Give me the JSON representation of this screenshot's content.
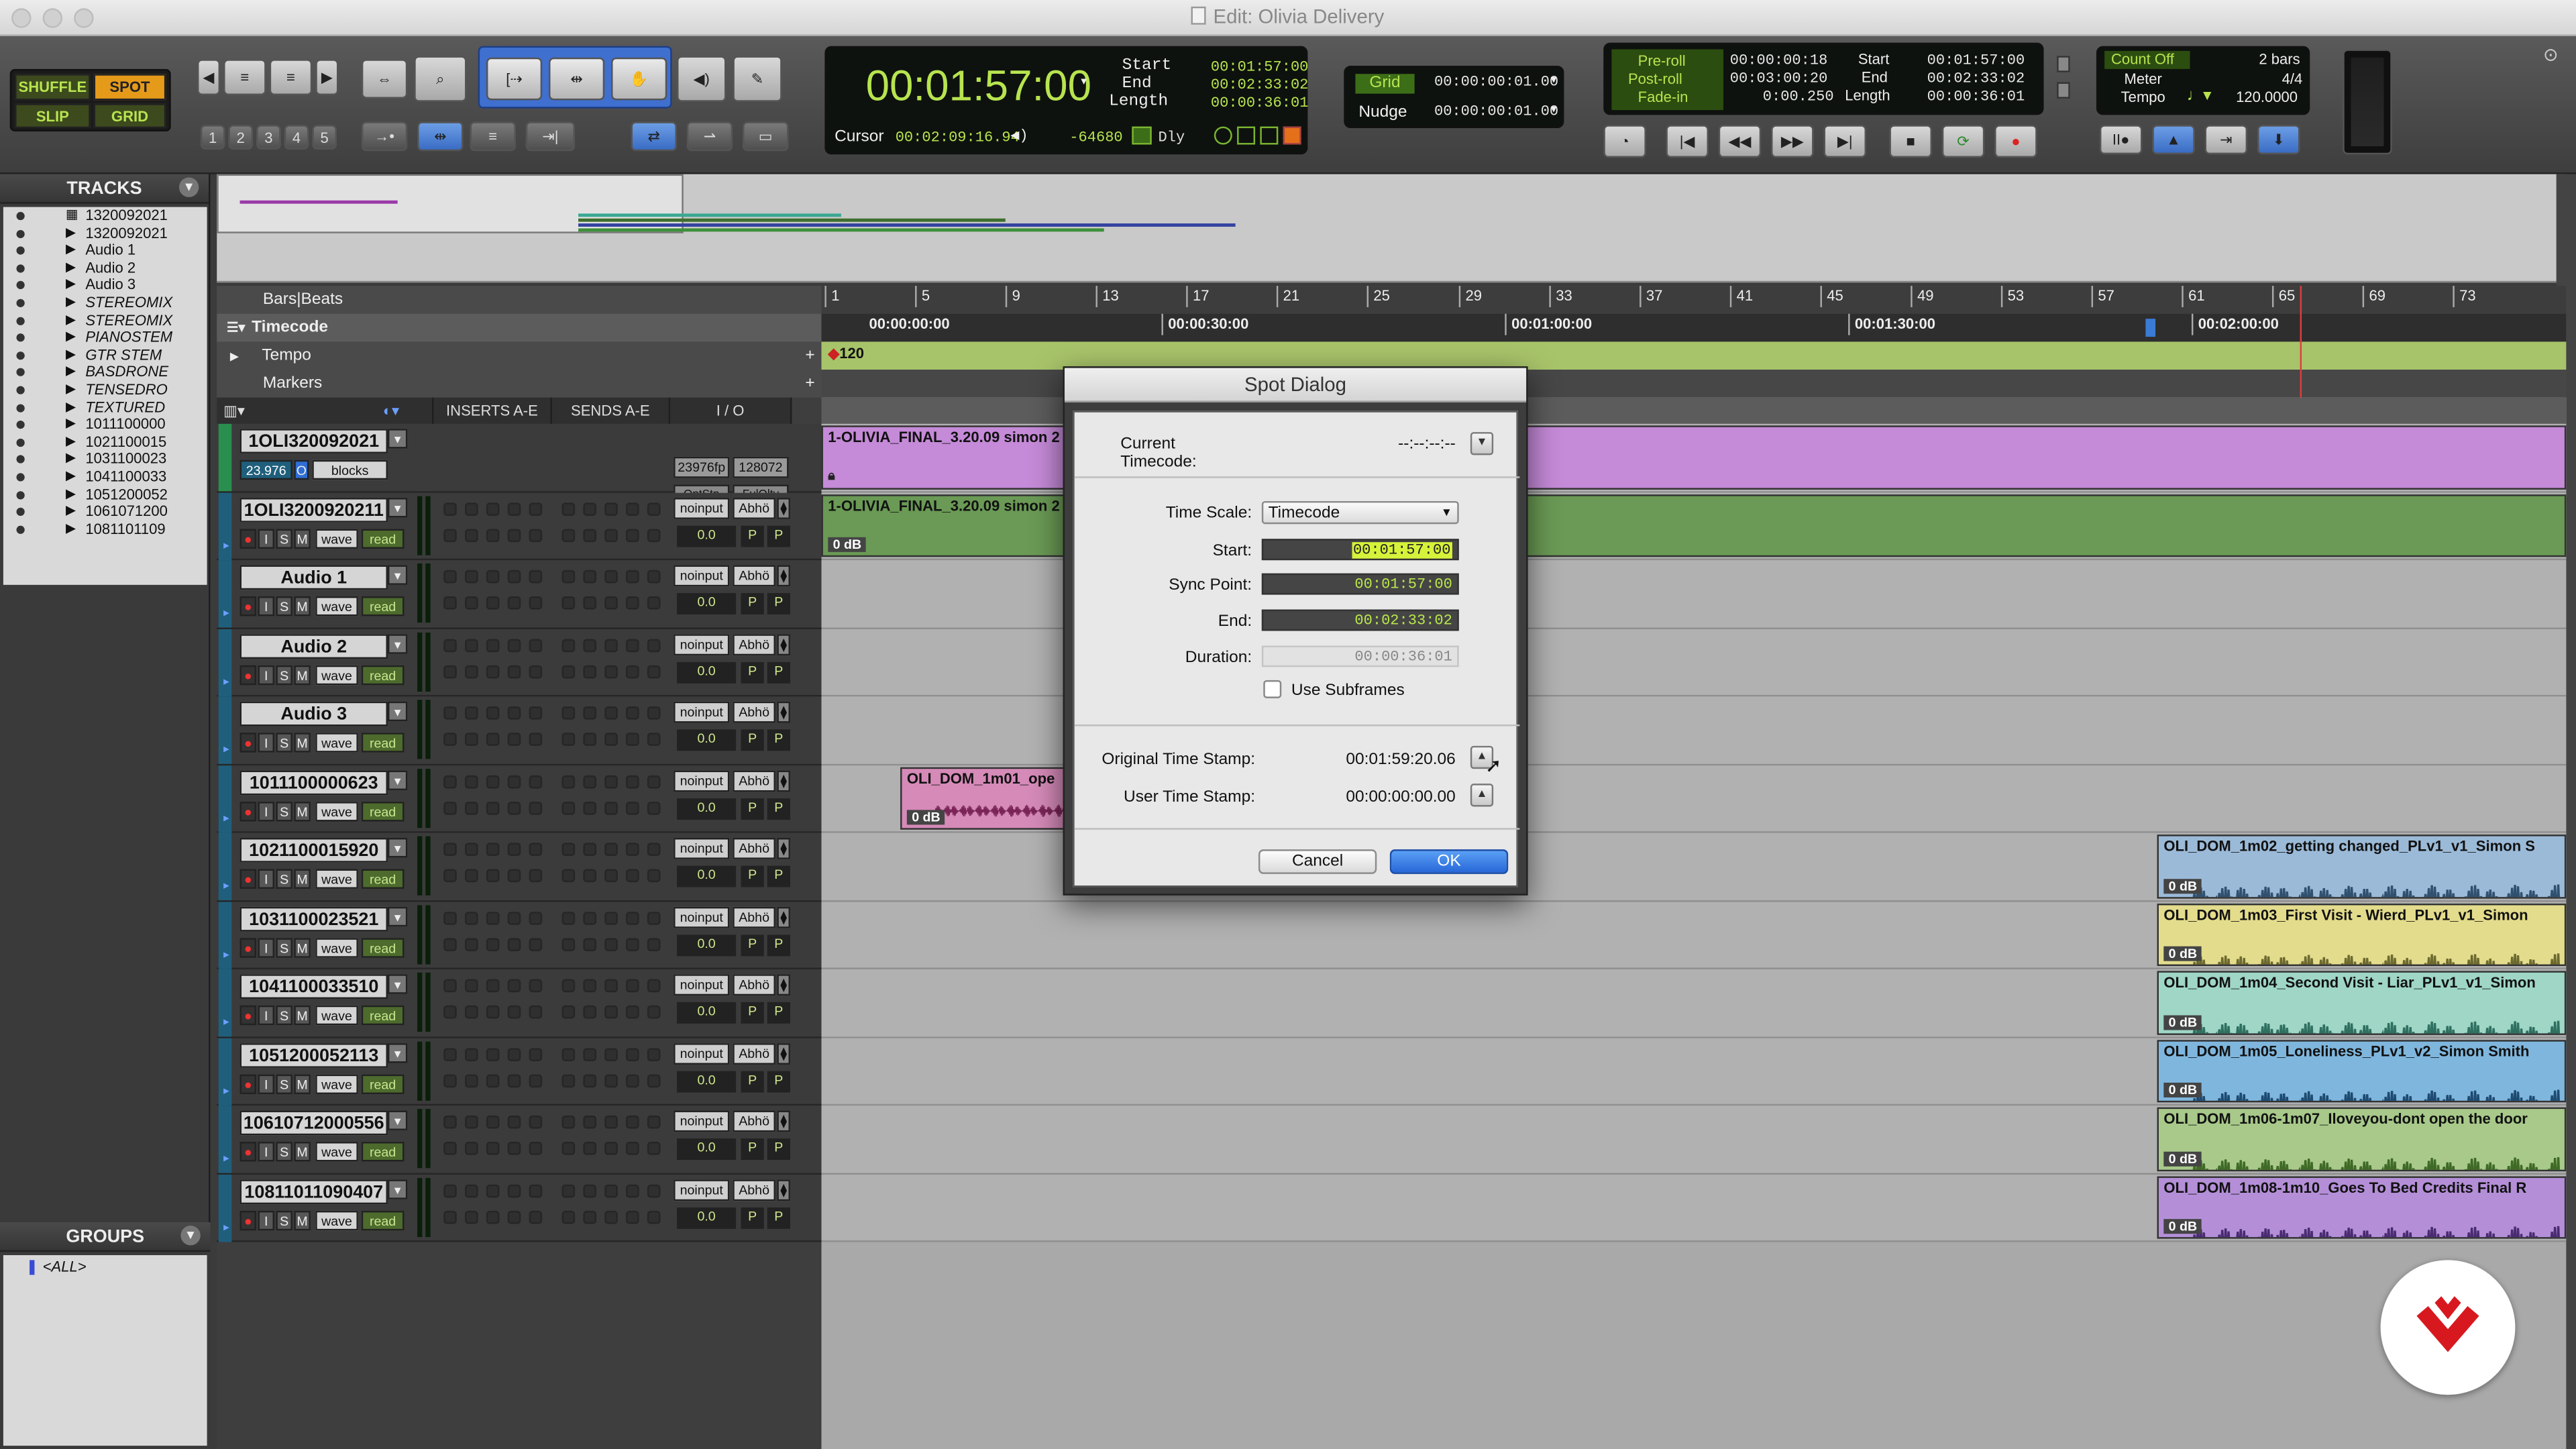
{
  "window": {
    "title": "Edit: Olivia Delivery"
  },
  "toolbar": {
    "modes": [
      "SHUFFLE",
      "SPOT",
      "SLIP",
      "GRID"
    ],
    "zoom_presets": [
      "1",
      "2",
      "3",
      "4",
      "5"
    ],
    "main_counter": "00:01:57:00",
    "start_label": "Start",
    "start": "00:01:57:00",
    "end_label": "End",
    "end": "00:02:33:02",
    "length_label": "Length",
    "length": "00:00:36:01",
    "cursor_label": "Cursor",
    "cursor": "00:02:09:16.94",
    "cursor_sample": "-64680",
    "dly_label": "Dly",
    "grid_label": "Grid",
    "grid_value": "00:00:00:01.00",
    "nudge_label": "Nudge",
    "nudge_value": "00:00:00:01.00",
    "preroll_label": "Pre-roll",
    "preroll": "00:00:00:18",
    "postroll_label": "Post-roll",
    "postroll": "00:03:00:20",
    "fadein_label": "Fade-in",
    "fadein": "0:00.250",
    "t_start_label": "Start",
    "t_start": "00:01:57:00",
    "t_end_label": "End",
    "t_end": "00:02:33:02",
    "t_length_label": "Length",
    "t_length": "00:00:36:01",
    "countoff_label": "Count Off",
    "countoff": "2 bars",
    "meter_label": "Meter",
    "meter": "4/4",
    "tempo_label": "Tempo",
    "tempo": "120.0000"
  },
  "tracks_panel": {
    "title": "TRACKS",
    "items": [
      {
        "label": "1320092021",
        "italic": false
      },
      {
        "label": "1320092021",
        "italic": false
      },
      {
        "label": "Audio 1",
        "italic": false
      },
      {
        "label": "Audio 2",
        "italic": false
      },
      {
        "label": "Audio 3",
        "italic": false
      },
      {
        "label": "STEREOMIX",
        "italic": true
      },
      {
        "label": "STEREOMIX",
        "italic": true
      },
      {
        "label": "PIANOSTEM",
        "italic": true
      },
      {
        "label": "GTR STEM",
        "italic": true
      },
      {
        "label": "BASDRONE",
        "italic": true
      },
      {
        "label": "TENSEDRO",
        "italic": true
      },
      {
        "label": "TEXTURED",
        "italic": true
      },
      {
        "label": "1011100000",
        "italic": false
      },
      {
        "label": "1021100015",
        "italic": false
      },
      {
        "label": "1031100023",
        "italic": false
      },
      {
        "label": "1041100033",
        "italic": false
      },
      {
        "label": "1051200052",
        "italic": false
      },
      {
        "label": "1061071200",
        "italic": false
      },
      {
        "label": "1081101109",
        "italic": false
      }
    ]
  },
  "groups_panel": {
    "title": "GROUPS",
    "all": "<ALL>"
  },
  "rulers": {
    "bars_beats_label": "Bars|Beats",
    "timecode_label": "Timecode",
    "tempo_label": "Tempo",
    "markers_label": "Markers",
    "tempo_value": "120",
    "bar_ticks": [
      "1",
      "5",
      "9",
      "13",
      "17",
      "21",
      "25",
      "29",
      "33",
      "37",
      "41",
      "45",
      "49",
      "53",
      "57",
      "61",
      "65",
      "69",
      "73"
    ],
    "tc_ticks": [
      "00:00:00:00",
      "00:00:30:00",
      "00:01:00:00",
      "00:01:30:00",
      "00:02:00:00"
    ]
  },
  "track_columns": {
    "inserts": "INSERTS A-E",
    "sends": "SENDS A-E",
    "io": "I / O"
  },
  "tracks": [
    {
      "name": "1OLI320092021",
      "color": "#2a8f4e",
      "video": true,
      "fps": "23.976",
      "mode": "blocks",
      "io1": "23976fp",
      "io2": "128072",
      "io3": "OptStn",
      "io4": "FulQlty"
    },
    {
      "name": "1OLI3200920211",
      "color": "#1f5f7c",
      "input": "noinput",
      "out": "Abhö",
      "vol": "0.0"
    },
    {
      "name": "Audio 1",
      "color": "#1f5f7c",
      "input": "noinput",
      "out": "Abhö",
      "vol": "0.0"
    },
    {
      "name": "Audio 2",
      "color": "#1f5f7c",
      "input": "noinput",
      "out": "Abhö",
      "vol": "0.0"
    },
    {
      "name": "Audio 3",
      "color": "#1f5f7c",
      "input": "noinput",
      "out": "Abhö",
      "vol": "0.0"
    },
    {
      "name": "1011100000623",
      "color": "#1f5f7c",
      "input": "noinput",
      "out": "Abhö",
      "vol": "0.0"
    },
    {
      "name": "1021100015920",
      "color": "#1f5f7c",
      "input": "noinput",
      "out": "Abhö",
      "vol": "0.0"
    },
    {
      "name": "1031100023521",
      "color": "#1f5f7c",
      "input": "noinput",
      "out": "Abhö",
      "vol": "0.0"
    },
    {
      "name": "1041100033510",
      "color": "#1f5f7c",
      "input": "noinput",
      "out": "Abhö",
      "vol": "0.0"
    },
    {
      "name": "1051200052113",
      "color": "#1f5f7c",
      "input": "noinput",
      "out": "Abhö",
      "vol": "0.0"
    },
    {
      "name": "10610712000556",
      "color": "#1f5f7c",
      "input": "noinput",
      "out": "Abhö",
      "vol": "0.0"
    },
    {
      "name": "10811011090407",
      "color": "#1f5f7c",
      "input": "noinput",
      "out": "Abhö",
      "vol": "0.0"
    }
  ],
  "track_buttons": {
    "rec": "●",
    "i": "I",
    "s": "S",
    "m": "M",
    "wave": "wave",
    "read": "read",
    "p": "P"
  },
  "clips": {
    "video": "1-OLIVIA_FINAL_3.20.09 simon 2",
    "audio": "1-OLIVIA_FINAL_3.20.09 simon 2",
    "c01": "OLI_DOM_1m01_ope",
    "c02": "OLI_DOM_1m02_getting changed_PLv1_v1_Simon S",
    "c03": "OLI_DOM_1m03_First Visit - Wierd_PLv1_v1_Simon",
    "c04": "OLI_DOM_1m04_Second Visit - Liar_PLv1_v1_Simon",
    "c05": "OLI_DOM_1m05_Loneliness_PLv1_v2_Simon Smith",
    "c06": "OLI_DOM_1m06-1m07_Iloveyou-dont open the door",
    "c08": "OLI_DOM_1m08-1m10_Goes To Bed Credits Final R",
    "gain": "0 dB"
  },
  "spot_dialog": {
    "title": "Spot Dialog",
    "current_timecode_label": "Current Timecode:",
    "current_timecode": "--:--:--:--",
    "time_scale_label": "Time Scale:",
    "time_scale": "Timecode",
    "start_label": "Start:",
    "start": "00:01:57:00",
    "sync_label": "Sync Point:",
    "sync": "00:01:57:00",
    "end_label": "End:",
    "end": "00:02:33:02",
    "duration_label": "Duration:",
    "duration": "00:00:36:01",
    "subframes_label": "Use Subframes",
    "original_ts_label": "Original Time Stamp:",
    "original_ts": "00:01:59:20.06",
    "user_ts_label": "User Time Stamp:",
    "user_ts": "00:00:00:00.00",
    "cancel": "Cancel",
    "ok": "OK"
  },
  "colors": {
    "accent_green": "#b7e44f",
    "selection": "#d7f23a",
    "ok_blue": "#2f7be0"
  }
}
